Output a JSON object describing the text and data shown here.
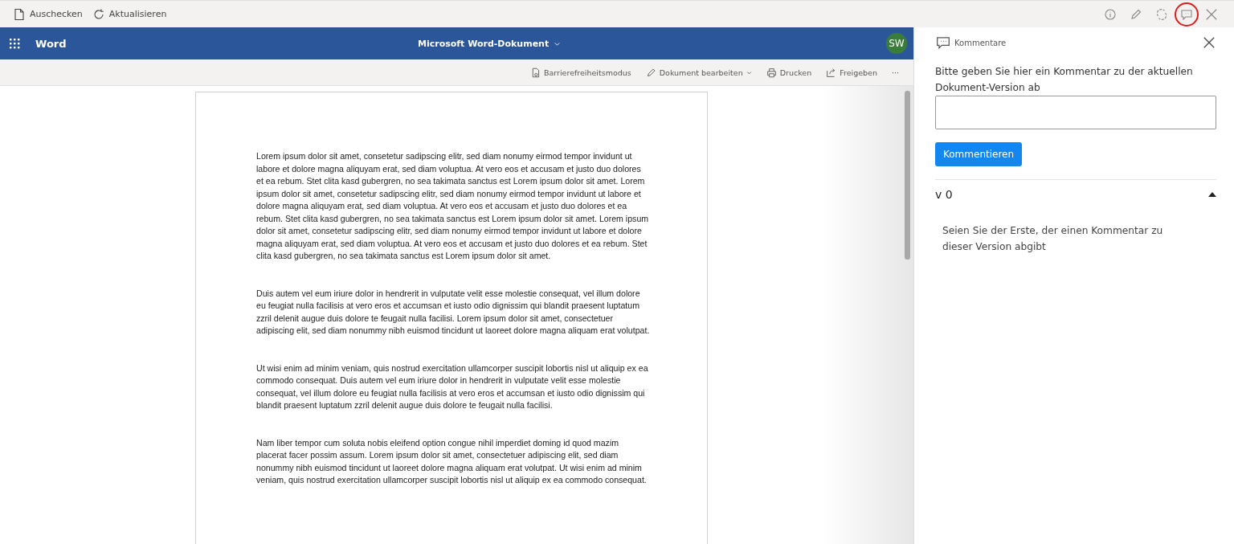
{
  "top_bar": {
    "actions": [
      {
        "kind": "file",
        "label": "Auschecken"
      },
      {
        "kind": "refresh",
        "label": "Aktualisieren"
      }
    ],
    "icons": [
      {
        "kind": "info",
        "highlighted": false
      },
      {
        "kind": "pencil",
        "highlighted": false
      },
      {
        "kind": "sync",
        "highlighted": false
      },
      {
        "kind": "comment",
        "highlighted": true
      },
      {
        "kind": "close",
        "highlighted": false
      }
    ]
  },
  "word": {
    "app_name": "Word",
    "document_title": "Microsoft Word-Dokument",
    "avatar": "SW",
    "commands": [
      {
        "kind": "accessibility",
        "label": "Barrierefreiheitsmodus"
      },
      {
        "kind": "edit",
        "label": "Dokument bearbeiten",
        "dropdown": true
      },
      {
        "kind": "print",
        "label": "Drucken"
      },
      {
        "kind": "share",
        "label": "Freigeben"
      },
      {
        "kind": "more",
        "label": "···"
      }
    ],
    "paragraphs": [
      "Lorem ipsum dolor sit amet, consetetur sadipscing elitr, sed diam nonumy eirmod tempor invidunt ut labore et dolore magna aliquyam erat, sed diam voluptua. At vero eos et accusam et justo duo dolores et ea rebum. Stet clita kasd gubergren, no sea takimata sanctus est Lorem ipsum dolor sit amet. Lorem ipsum dolor sit amet, consetetur sadipscing elitr, sed diam nonumy eirmod tempor invidunt ut labore et dolore magna aliquyam erat, sed diam voluptua. At vero eos et accusam et justo duo dolores et ea rebum. Stet clita kasd gubergren, no sea takimata sanctus est Lorem ipsum dolor sit amet. Lorem ipsum dolor sit amet, consetetur sadipscing elitr, sed diam nonumy eirmod tempor invidunt ut labore et dolore magna aliquyam erat, sed diam voluptua. At vero eos et accusam et justo duo dolores et ea rebum. Stet clita kasd gubergren, no sea takimata sanctus est Lorem ipsum dolor sit amet.",
      "Duis autem vel eum iriure dolor in hendrerit in vulputate velit esse molestie consequat, vel illum dolore eu feugiat nulla facilisis at vero eros et accumsan et iusto odio dignissim qui blandit praesent luptatum zzril delenit augue duis dolore te feugait nulla facilisi. Lorem ipsum dolor sit amet, consectetuer adipiscing elit, sed diam nonummy nibh euismod tincidunt ut laoreet dolore magna aliquam erat volutpat.",
      "Ut wisi enim ad minim veniam, quis nostrud exercitation ullamcorper suscipit lobortis nisl ut aliquip ex ea commodo consequat. Duis autem vel eum iriure dolor in hendrerit in vulputate velit esse molestie consequat, vel illum dolore eu feugiat nulla facilisis at vero eros et accumsan et iusto odio dignissim qui blandit praesent luptatum zzril delenit augue duis dolore te feugait nulla facilisi.",
      "Nam liber tempor cum soluta nobis eleifend option congue nihil imperdiet doming id quod mazim placerat facer possim assum. Lorem ipsum dolor sit amet, consectetuer adipiscing elit, sed diam nonummy nibh euismod tincidunt ut laoreet dolore magna aliquam erat volutpat. Ut wisi enim ad minim veniam, quis nostrud exercitation ullamcorper suscipit lobortis nisl ut aliquip ex ea commodo consequat."
    ]
  },
  "comments_panel": {
    "title": "Kommentare",
    "prompt": "Bitte geben Sie hier ein Kommentar zu der aktuellen Dokument-Version ab",
    "submit_button": "Kommentieren",
    "versions": [
      {
        "label": "v 0",
        "expanded": true,
        "empty_message": "Seien Sie der Erste, der einen Kommentar zu dieser Version abgibt"
      }
    ]
  }
}
